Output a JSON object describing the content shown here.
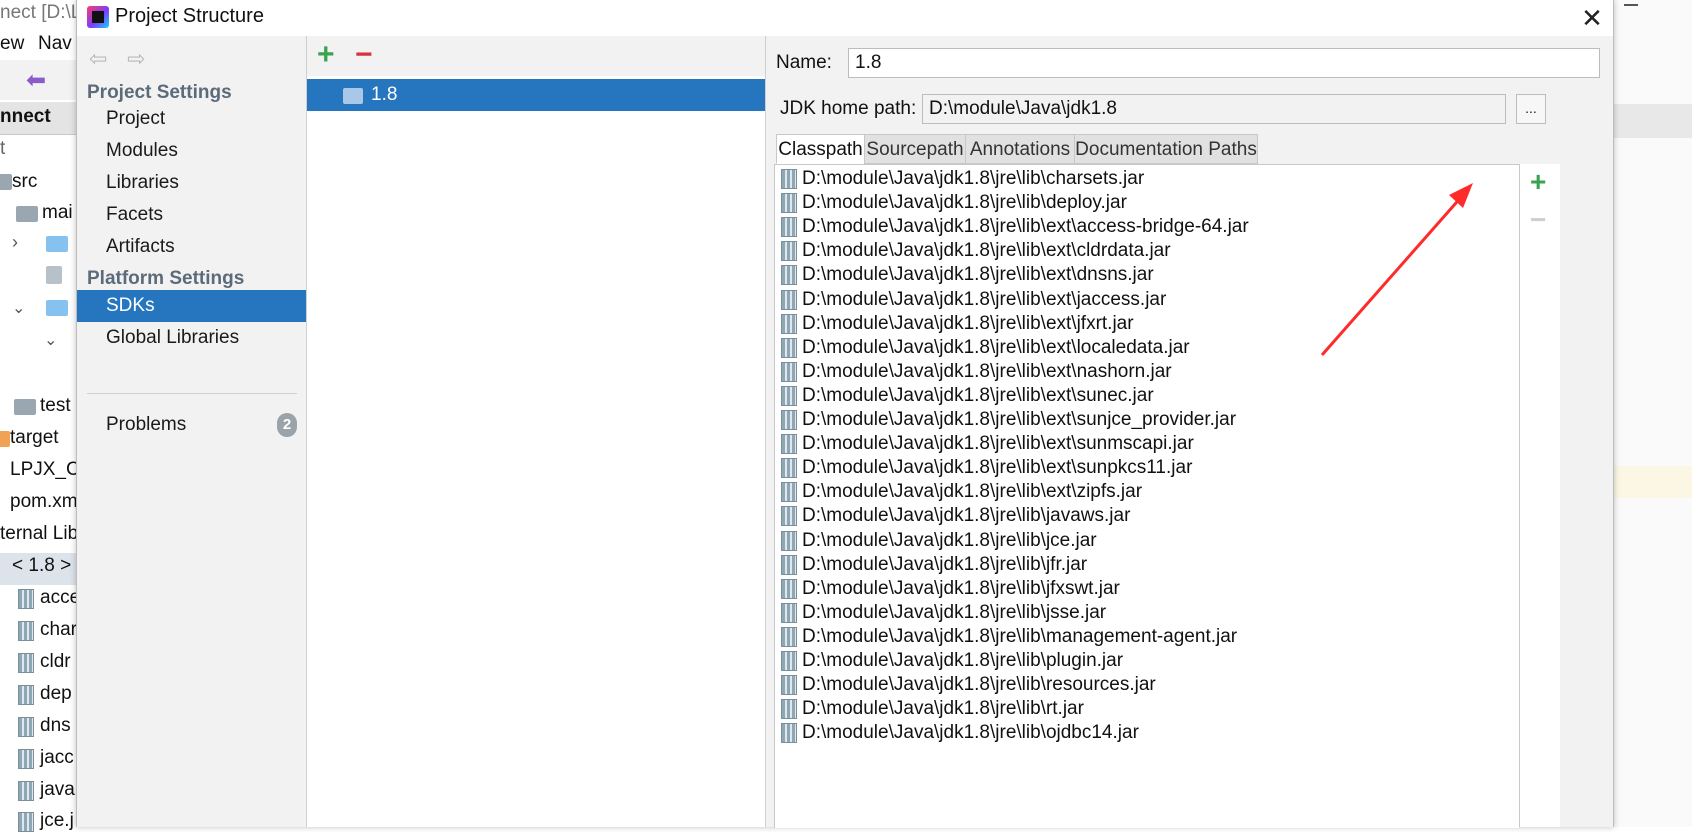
{
  "background_ide": {
    "title_fragment": "nect [D:\\L",
    "menu": [
      "ew",
      "Nav"
    ],
    "tab_fragment": "nnect",
    "panel_fragment": "t",
    "tree": [
      {
        "label": "src"
      },
      {
        "label": "mai"
      },
      {
        "label": "test"
      },
      {
        "label": "target"
      },
      {
        "label": "LPJX_Co"
      },
      {
        "label": "pom.xm"
      },
      {
        "label": "ternal Lib"
      },
      {
        "label": "< 1.8 >"
      },
      {
        "label": "acce"
      },
      {
        "label": "char"
      },
      {
        "label": "cldr"
      },
      {
        "label": "dep"
      },
      {
        "label": "dns"
      },
      {
        "label": "jacc"
      },
      {
        "label": "java"
      },
      {
        "label": "jce.j"
      }
    ]
  },
  "dialog": {
    "title": "Project Structure",
    "close_icon": "close-icon",
    "nav": {
      "back_icon": "arrow-left-icon",
      "forward_icon": "arrow-right-icon",
      "project_settings_heading": "Project Settings",
      "project_items": [
        "Project",
        "Modules",
        "Libraries",
        "Facets",
        "Artifacts"
      ],
      "platform_settings_heading": "Platform Settings",
      "platform_items": [
        "SDKs",
        "Global Libraries"
      ],
      "selected": "SDKs",
      "problems_label": "Problems",
      "problems_count": "2"
    },
    "sdk_list": {
      "add_icon": "plus-icon",
      "remove_icon": "minus-icon",
      "items": [
        "1.8"
      ],
      "selected": "1.8"
    },
    "detail": {
      "name_label": "Name:",
      "name_value": "1.8",
      "jdk_home_label": "JDK home path:",
      "jdk_home_value": "D:\\module\\Java\\jdk1.8",
      "browse_label": "...",
      "tabs": [
        "Classpath",
        "Sourcepath",
        "Annotations",
        "Documentation Paths"
      ],
      "active_tab": "Classpath",
      "classpath": [
        "D:\\module\\Java\\jdk1.8\\jre\\lib\\charsets.jar",
        "D:\\module\\Java\\jdk1.8\\jre\\lib\\deploy.jar",
        "D:\\module\\Java\\jdk1.8\\jre\\lib\\ext\\access-bridge-64.jar",
        "D:\\module\\Java\\jdk1.8\\jre\\lib\\ext\\cldrdata.jar",
        "D:\\module\\Java\\jdk1.8\\jre\\lib\\ext\\dnsns.jar",
        "D:\\module\\Java\\jdk1.8\\jre\\lib\\ext\\jaccess.jar",
        "D:\\module\\Java\\jdk1.8\\jre\\lib\\ext\\jfxrt.jar",
        "D:\\module\\Java\\jdk1.8\\jre\\lib\\ext\\localedata.jar",
        "D:\\module\\Java\\jdk1.8\\jre\\lib\\ext\\nashorn.jar",
        "D:\\module\\Java\\jdk1.8\\jre\\lib\\ext\\sunec.jar",
        "D:\\module\\Java\\jdk1.8\\jre\\lib\\ext\\sunjce_provider.jar",
        "D:\\module\\Java\\jdk1.8\\jre\\lib\\ext\\sunmscapi.jar",
        "D:\\module\\Java\\jdk1.8\\jre\\lib\\ext\\sunpkcs11.jar",
        "D:\\module\\Java\\jdk1.8\\jre\\lib\\ext\\zipfs.jar",
        "D:\\module\\Java\\jdk1.8\\jre\\lib\\javaws.jar",
        "D:\\module\\Java\\jdk1.8\\jre\\lib\\jce.jar",
        "D:\\module\\Java\\jdk1.8\\jre\\lib\\jfr.jar",
        "D:\\module\\Java\\jdk1.8\\jre\\lib\\jfxswt.jar",
        "D:\\module\\Java\\jdk1.8\\jre\\lib\\jsse.jar",
        "D:\\module\\Java\\jdk1.8\\jre\\lib\\management-agent.jar",
        "D:\\module\\Java\\jdk1.8\\jre\\lib\\plugin.jar",
        "D:\\module\\Java\\jdk1.8\\jre\\lib\\resources.jar",
        "D:\\module\\Java\\jdk1.8\\jre\\lib\\rt.jar",
        "D:\\module\\Java\\jdk1.8\\jre\\lib\\ojdbc14.jar"
      ],
      "side_add_icon": "plus-icon",
      "side_remove_icon": "minus-icon"
    },
    "annotation": {
      "arrow_color": "#ff2a2a"
    }
  },
  "colors": {
    "selection": "#2675bf",
    "add_green": "#3aa351",
    "remove_red": "#d8323c",
    "heading": "#5c6b7a"
  }
}
